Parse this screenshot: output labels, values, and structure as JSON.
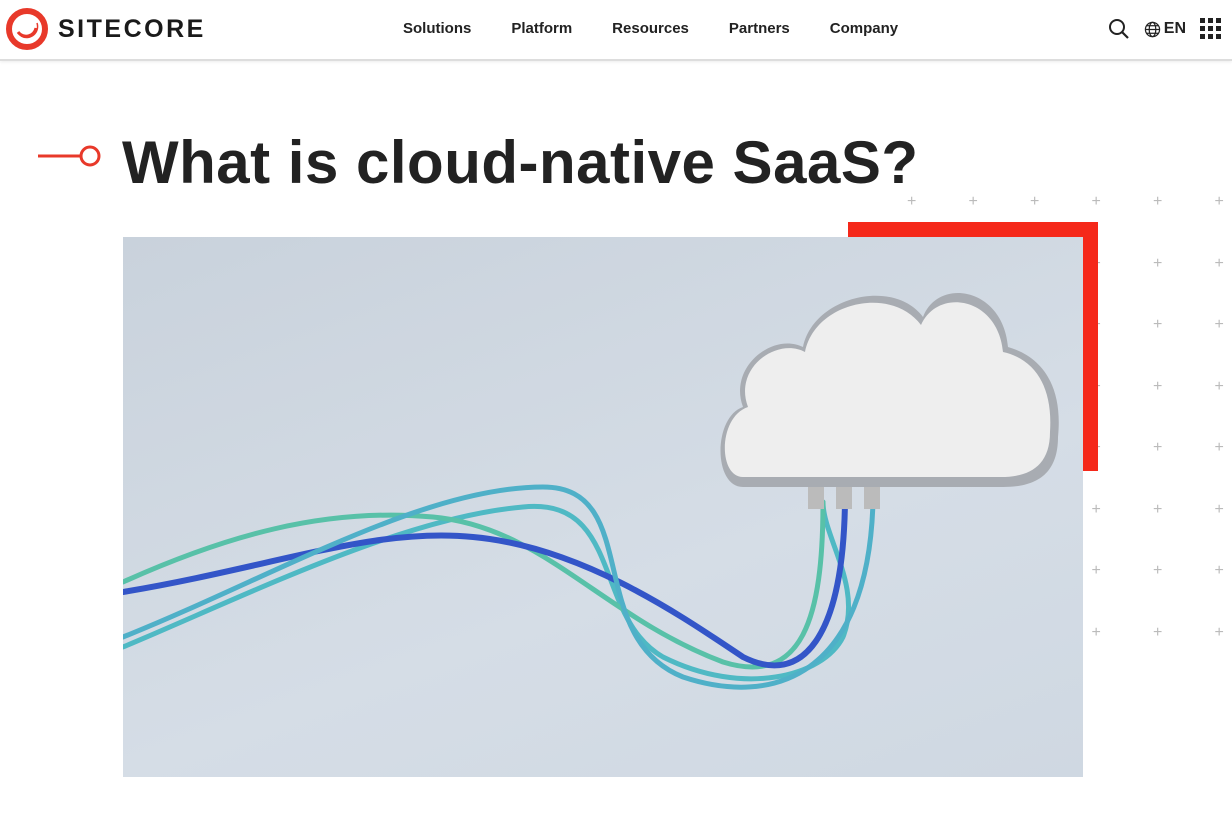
{
  "brand": {
    "name": "SITECORE",
    "color": "#e8392a"
  },
  "nav": {
    "items": [
      "Solutions",
      "Platform",
      "Resources",
      "Partners",
      "Company"
    ]
  },
  "utility": {
    "search_icon": "search-icon",
    "language": "EN",
    "globe_icon": "globe-icon",
    "apps_icon": "grid-icon"
  },
  "main": {
    "title": "What is cloud-native SaaS?"
  },
  "colors": {
    "accent": "#f5281a",
    "text": "#222222"
  }
}
